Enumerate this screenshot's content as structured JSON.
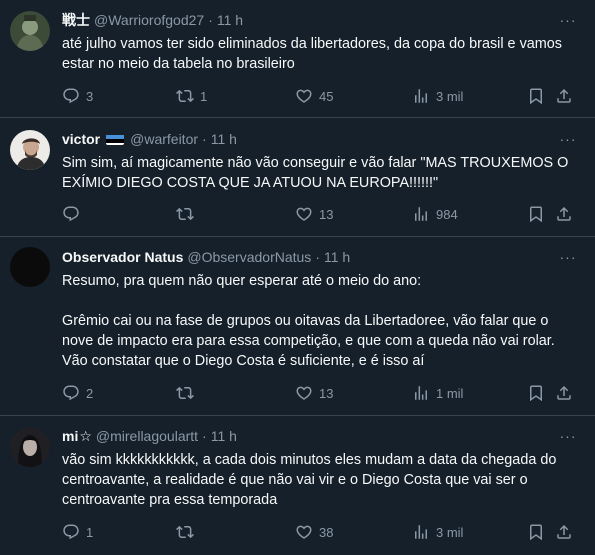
{
  "tweets": [
    {
      "name": "戦士",
      "handle": "@Warriorofgod27",
      "dot": "·",
      "time": "11 h",
      "text": "até julho vamos ter sido eliminados da libertadores, da copa do brasil e vamos estar no meio da tabela no brasileiro",
      "replies": "3",
      "retweets": "1",
      "likes": "45",
      "views": "3 mil",
      "avatar_color": "#4a5a3f"
    },
    {
      "name": "victor",
      "handle": "@warfeitor",
      "dot": "·",
      "time": "11 h",
      "text": "Sim sim, aí magicamente não vão conseguir e vão falar \"MAS TROUXEMOS O EXÍMIO DIEGO COSTA QUE JA ATUOU NA EUROPA!!!!!!\"",
      "replies": "",
      "retweets": "",
      "likes": "13",
      "views": "984",
      "avatar_color": "#e8e6e3"
    },
    {
      "name": "Observador Natus",
      "handle": "@ObservadorNatus",
      "dot": "·",
      "time": "11 h",
      "text": "Resumo, pra quem não quer esperar até o meio do ano:\n\nGrêmio cai ou na fase de grupos ou oitavas da Libertadoree, vão falar que o nove de impacto era para essa competição, e que com a queda não vai rolar. Vão constatar que o Diego Costa é suficiente, e é isso aí",
      "replies": "2",
      "retweets": "",
      "likes": "13",
      "views": "1 mil",
      "avatar_color": "#0b0b0b"
    },
    {
      "name": "mi",
      "name_symbol": "☆",
      "handle": "@mirellagoulartt",
      "dot": "·",
      "time": "11 h",
      "text": "vão sim kkkkkkkkkkk, a cada dois minutos eles mudam a data da chegada do centroavante, a realidade é que não vai vir e o Diego Costa que vai ser o centroavante pra essa temporada",
      "replies": "1",
      "retweets": "",
      "likes": "38",
      "views": "3 mil",
      "avatar_color": "#2a2a2e"
    }
  ],
  "colors": {
    "background": "#15202b",
    "divider": "#38444d",
    "text": "#f7f9f9",
    "muted": "#8b98a5"
  },
  "icons": [
    "reply-icon",
    "retweet-icon",
    "like-icon",
    "views-icon",
    "bookmark-icon",
    "share-icon",
    "more-icon",
    "flag-icon"
  ]
}
